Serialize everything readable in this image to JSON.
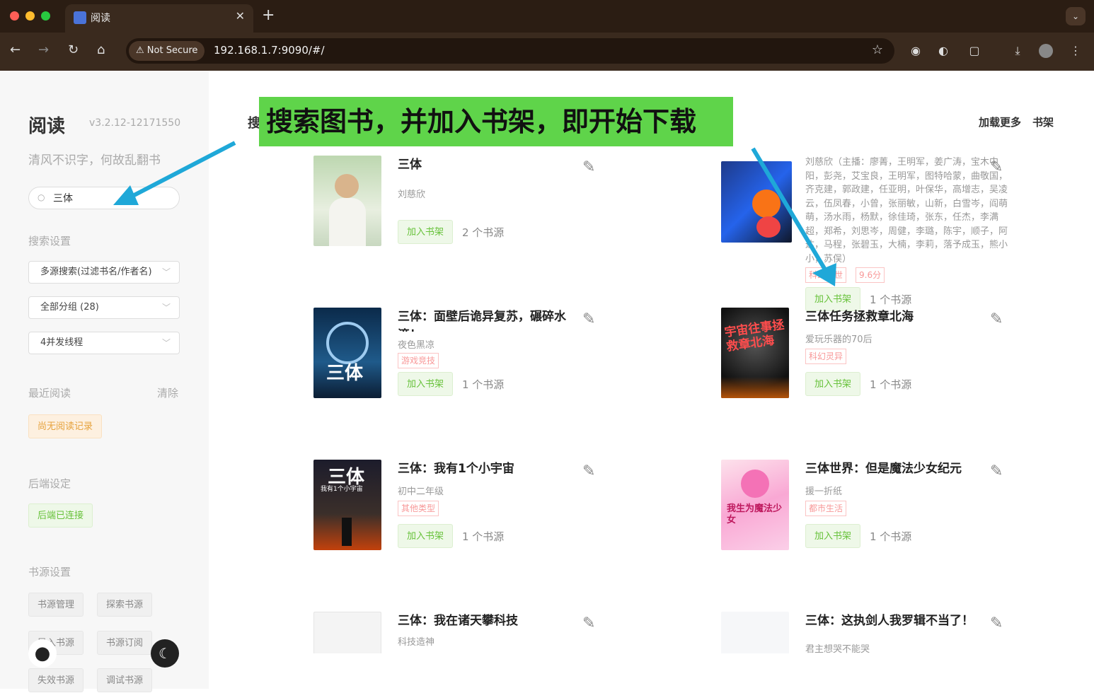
{
  "browser": {
    "tab_title": "阅读",
    "not_secure": "Not Secure",
    "url": "192.168.1.7:9090/#/"
  },
  "sidebar": {
    "brand": "阅读",
    "version": "v3.2.12-12171550",
    "slogan": "清风不识字，何故乱翻书",
    "search_value": "三体",
    "search_settings": "搜索设置",
    "select_mode": "多源搜索(过滤书名/作者名)",
    "select_group": "全部分组 (28)",
    "select_threads": "4并发线程",
    "recent_label": "最近阅读",
    "clear_label": "清除",
    "no_record": "尚无阅读记录",
    "backend_label": "后端设定",
    "backend_status": "后端已连接",
    "source_label": "书源设置",
    "source_buttons": [
      "书源管理",
      "探索书源",
      "导入书源",
      "书源订阅",
      "失效书源",
      "调试书源"
    ]
  },
  "main": {
    "search_prefix": "搜",
    "load_more": "加载更多",
    "bookshelf": "书架",
    "banner": "搜索图书，并加入书架，即开始下载",
    "add_label": "加入书架",
    "books": [
      {
        "title": "三体",
        "author": "刘慈欣",
        "category": "",
        "sources": "2 个书源"
      },
      {
        "title": "",
        "author": "刘慈欣（主播：廖菁，王明军，姜广涛，宝木中阳，彭尧，艾宝良，王明军，图特哈蒙，曲敬国，齐克建，郭政建，任亚明，叶保华，高增志，吴凌云，伍凤春，小曾，张丽敏，山新，白雪岑，阎萌萌，汤水雨，杨默，徐佳琦，张东，任杰，李满超，郑希，刘思岑，周健，李璐，陈宇，顺子，阿达，马程，张碧玉，大楠，李莉，落予成玉，熊小小，苏俣）",
        "category": "科幻末世",
        "rating": "9.6分",
        "sources": "1 个书源"
      },
      {
        "title": "三体：面壁后诡异复苏，碾碎水滴！",
        "author": "夜色黑凉",
        "category": "游戏竞技",
        "sources": "1 个书源"
      },
      {
        "title": "三体任务拯救章北海",
        "author": "爱玩乐器的70后",
        "category": "科幻灵异",
        "sources": "1 个书源"
      },
      {
        "title": "三体：我有1个小宇宙",
        "author": "初中二年级",
        "category": "其他类型",
        "sources": "1 个书源"
      },
      {
        "title": "三体世界：但是魔法少女纪元",
        "author": "援一折纸",
        "category": "都市生活",
        "sources": "1 个书源"
      },
      {
        "title": "三体：我在诸天攀科技",
        "author": "科技造神",
        "category": "",
        "sources": ""
      },
      {
        "title": "三体：这执剑人我罗辑不当了！",
        "author": "君主想哭不能哭",
        "category": "",
        "sources": ""
      }
    ],
    "cover_texts": {
      "c3": "三体",
      "c4": "宇宙往事拯救章北海",
      "c5": "三体",
      "c5b": "我有1个小宇宙",
      "c6": "我生为魔法少女"
    }
  },
  "colors": {
    "accent_green": "#67c23a",
    "banner": "#5fd44a",
    "arrow": "#1fa8d8"
  }
}
